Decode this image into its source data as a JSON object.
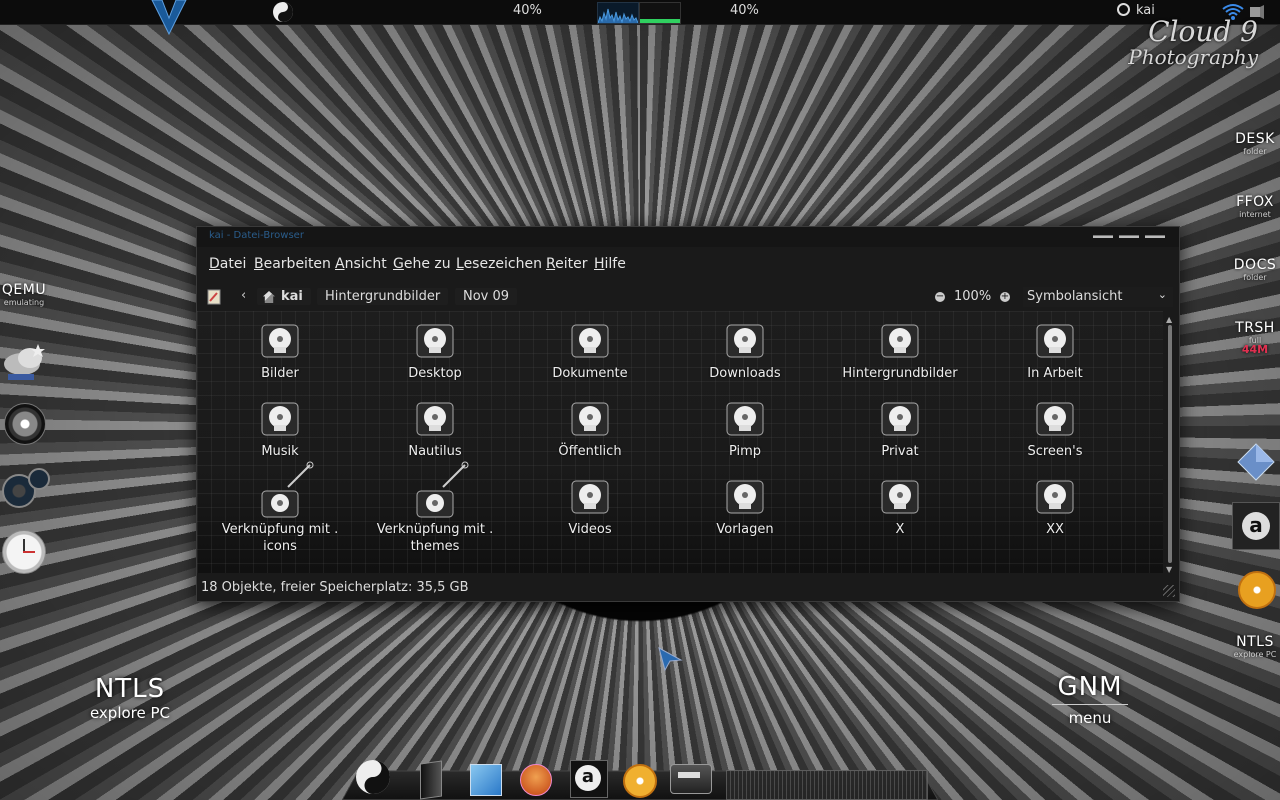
{
  "top_panel": {
    "cpu_percent": "40%",
    "mem_percent": "40%",
    "user": "kai"
  },
  "brand": {
    "line1": "Cloud 9",
    "line2": "Photography"
  },
  "right_launchers": [
    {
      "label": "DESK",
      "sub": "folder"
    },
    {
      "label": "FFOX",
      "sub": "internet"
    },
    {
      "label": "DOCS",
      "sub": "folder"
    },
    {
      "label": "TRSH",
      "sub": "full",
      "extra": "44M"
    },
    {
      "label": "NTLS",
      "sub": "explore PC"
    }
  ],
  "left_launchers": [
    {
      "label": "QEMU",
      "sub": "emulating"
    }
  ],
  "desktop_labels": {
    "ntls": {
      "title": "NTLS",
      "sub": "explore PC"
    },
    "gnm": {
      "title": "GNM",
      "sub": "menu"
    }
  },
  "window": {
    "title": "kai - Datei-Browser",
    "menu": [
      {
        "label": "Datei",
        "u": "D",
        "rest": "atei"
      },
      {
        "label": "Bearbeiten",
        "u": "B",
        "rest": "earbeiten"
      },
      {
        "label": "Ansicht",
        "u": "A",
        "rest": "nsicht"
      },
      {
        "label": "Gehe zu",
        "u": "G",
        "rest": "ehe zu"
      },
      {
        "label": "Lesezeichen",
        "u": "L",
        "rest": "esezeichen"
      },
      {
        "label": "Reiter",
        "u": "R",
        "rest": "eiter"
      },
      {
        "label": "Hilfe",
        "u": "H",
        "rest": "ilfe"
      }
    ],
    "breadcrumbs": [
      "kai",
      "Hintergrundbilder",
      "Nov 09"
    ],
    "zoom": "100%",
    "view_mode": "Symbolansicht",
    "files": [
      "Bilder",
      "Desktop",
      "Dokumente",
      "Downloads",
      "Hintergrundbilder",
      "In Arbeit",
      "Musik",
      "Nautilus",
      "Öffentlich",
      "Pimp",
      "Privat",
      "Screen's",
      "Verknüpfung mit . icons",
      "Verknüpfung mit . themes",
      "Videos",
      "Vorlagen",
      "X",
      "XX"
    ],
    "status": "18 Objekte, freier Speicherplatz: 35,5 GB"
  },
  "colors": {
    "accent": "#2a5c8a",
    "mem_fill": "#30d060"
  }
}
